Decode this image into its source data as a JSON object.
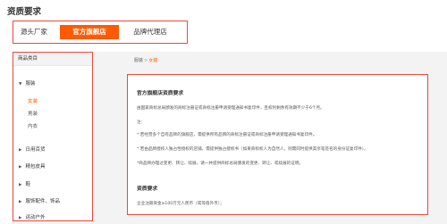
{
  "page_title": "资质要求",
  "tabs": [
    {
      "label": "源头厂家",
      "active": false
    },
    {
      "label": "官方旗舰店",
      "active": true
    },
    {
      "label": "品牌代理店",
      "active": false
    }
  ],
  "sidebar": {
    "header": "商品类目",
    "categories": [
      {
        "label": "服装",
        "expanded": true,
        "children": [
          {
            "label": "女装",
            "active": true
          },
          {
            "label": "男装",
            "active": false
          },
          {
            "label": "内衣",
            "active": false
          }
        ]
      },
      {
        "label": "日用百货"
      },
      {
        "label": "精包皮具"
      },
      {
        "label": "鞋"
      },
      {
        "label": "服饰配件、饰品"
      },
      {
        "label": "运动户外"
      }
    ]
  },
  "breadcrumb": {
    "root": "服装",
    "separator": ">",
    "current": "女装"
  },
  "content": {
    "title": "官方旗舰店资质要求",
    "intro": "由国家商标总局颁发的商标注册证或商标注册申请受理通知书复印件，且权利剩余有效期不少于6个月。",
    "note_label": "注：",
    "notes": [
      "* 若经营多个自有品牌的旗舰店，需提供所有品牌的商标注册证或商标注册申请受理通知书复印件。",
      "* 若由品牌授权人独占性授权的店铺，需提供独占授权书（如果商标权人为自然人，则需同时提供其亲笔签名的身份证复印件）。",
      "*商品牌办理过变更、转让、续展，请一并提供商标总局颁发的变更、转让、或续展的证明。"
    ],
    "qual_title": "资质要求",
    "qual_text": "企业注册资金≥100万元人民币（或等值外币）；"
  }
}
